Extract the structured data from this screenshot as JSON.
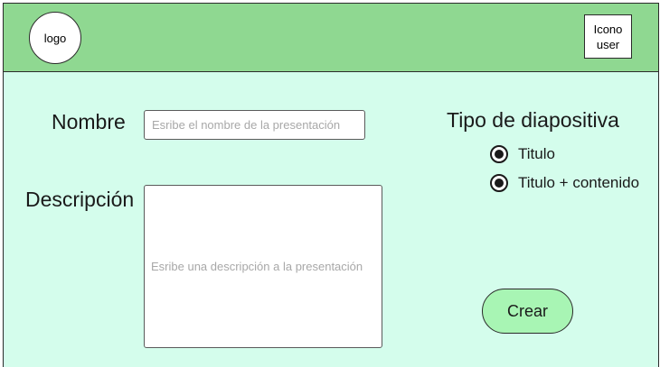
{
  "header": {
    "logo_label": "logo",
    "user_icon_label": "Icono\nuser"
  },
  "form": {
    "name_label": "Nombre",
    "name_placeholder": "Esribe el nombre de la presentación",
    "description_label": "Descripción",
    "description_placeholder": "Esribe una descripción a la presentación"
  },
  "slide_type": {
    "heading": "Tipo de diapositiva",
    "options": [
      {
        "label": "Titulo",
        "selected": true
      },
      {
        "label": "Titulo + contenido",
        "selected": true
      }
    ]
  },
  "actions": {
    "create_label": "Crear"
  },
  "colors": {
    "header_bg": "#8fd891",
    "page_bg": "#d4fdec",
    "button_bg": "#a8f5b4"
  }
}
